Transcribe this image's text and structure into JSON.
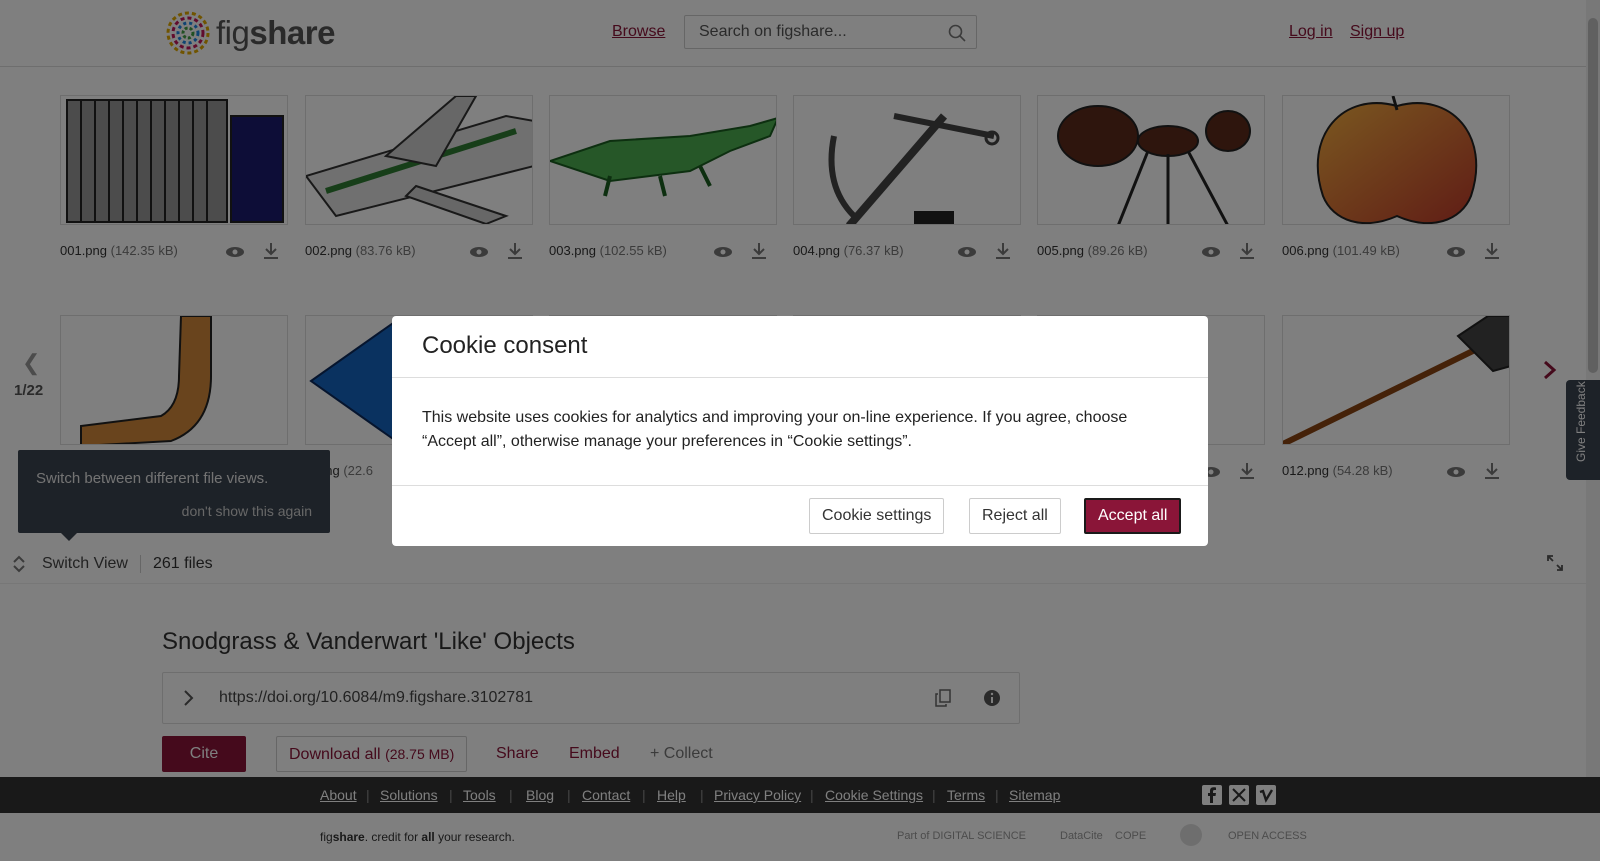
{
  "header": {
    "logo": {
      "fig": "fig",
      "share": "share"
    },
    "browse": "Browse",
    "search_placeholder": "Search on figshare...",
    "login": "Log in",
    "signup": "Sign up"
  },
  "gallery": {
    "pager": "1/22",
    "files": [
      {
        "name": "001.png",
        "size": "(142.35 kB)"
      },
      {
        "name": "002.png",
        "size": "(83.76 kB)"
      },
      {
        "name": "003.png",
        "size": "(102.55 kB)"
      },
      {
        "name": "004.png",
        "size": "(76.37 kB)"
      },
      {
        "name": "005.png",
        "size": "(89.26 kB)"
      },
      {
        "name": "006.png",
        "size": "(101.49 kB)"
      },
      {
        "name": "",
        "size": ""
      },
      {
        "name": "png",
        "size": "(22.6"
      },
      {
        "name": "",
        "size": ""
      },
      {
        "name": "",
        "size": ""
      },
      {
        "name": "",
        "size": ""
      },
      {
        "name": "012.png",
        "size": "(54.28 kB)"
      }
    ],
    "tooltip": {
      "text": "Switch between different file views.",
      "dismiss": "don't show this again"
    }
  },
  "switchbar": {
    "switch_view": "Switch View",
    "files_count": "261 files"
  },
  "item": {
    "title": "Snodgrass & Vanderwart 'Like' Objects",
    "doi": "https://doi.org/10.6084/m9.figshare.3102781",
    "cite": "Cite",
    "download_all": "Download all",
    "download_size": "(28.75 MB)",
    "share": "Share",
    "embed": "Embed",
    "collect": "+ Collect"
  },
  "footer": {
    "links": [
      "About",
      "Solutions",
      "Tools",
      "Blog",
      "Contact",
      "Help",
      "Privacy Policy",
      "Cookie Settings",
      "Terms",
      "Sitemap"
    ],
    "credit_fig": "fig",
    "credit_share": "share",
    "credit_rest1": ". credit for ",
    "credit_all": "all",
    "credit_rest2": " your research.",
    "partners": [
      "Part of DIGITAL SCIENCE",
      "DataCite",
      "COPE",
      "",
      "OPEN ACCESS"
    ]
  },
  "feedback": "Give Feedback",
  "cookie": {
    "title": "Cookie consent",
    "body": "This website uses cookies for analytics and improving your on-line experience. If you agree, choose “Accept all”, otherwise manage your preferences in “Cookie settings”.",
    "settings": "Cookie settings",
    "reject": "Reject all",
    "accept": "Accept all"
  },
  "colors": {
    "brand": "#8a1538",
    "dark": "#333333",
    "tooltip": "#3a4450"
  }
}
